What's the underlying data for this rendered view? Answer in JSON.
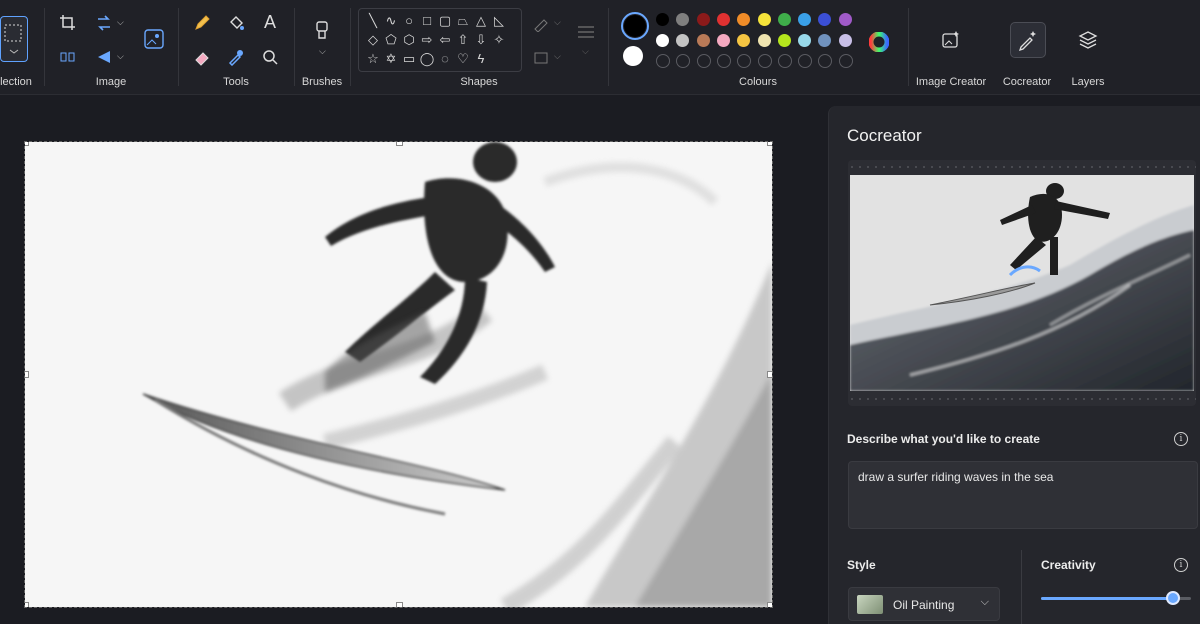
{
  "toolbar": {
    "groups": {
      "selection": "election",
      "image": "Image",
      "tools": "Tools",
      "brushes": "Brushes",
      "shapes": "Shapes",
      "colours": "Colours",
      "image_creator": "Image Creator",
      "cocreator": "Cocreator",
      "layers": "Layers"
    },
    "tools_text_glyph": "A",
    "colours": {
      "primary": "#000000",
      "secondary": "#ffffff",
      "row1": [
        "#000000",
        "#7f7f7f",
        "#8b1a1a",
        "#e03131",
        "#f08c28",
        "#f5e33a",
        "#3fae4a",
        "#3aa0e8",
        "#3b4fd6",
        "#a05ac8"
      ],
      "row2": [
        "#ffffff",
        "#c3c3c3",
        "#b97a57",
        "#f4a9c0",
        "#f5c542",
        "#efe4b0",
        "#b5e61d",
        "#99d9ea",
        "#7092be",
        "#c8bfe7"
      ]
    }
  },
  "panel": {
    "title": "Cocreator",
    "describe_label": "Describe what you'd like to create",
    "prompt_value": "draw a surfer riding waves in the sea",
    "style_label": "Style",
    "style_value": "Oil Painting",
    "creativity_label": "Creativity",
    "creativity_level": 0.88
  }
}
